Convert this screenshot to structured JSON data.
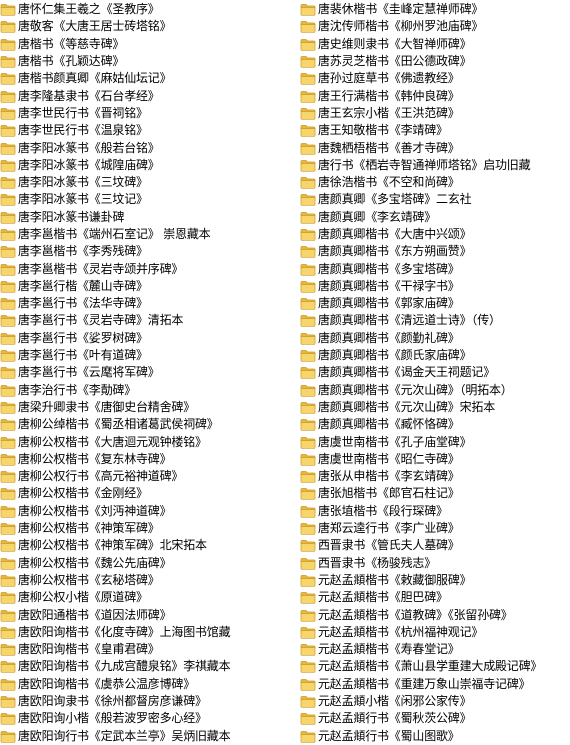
{
  "icon": {
    "name": "folder-icon",
    "body": "#f6d66a",
    "tab": "#e9b936",
    "edge": "#c9982a"
  },
  "left": [
    "唐怀仁集王羲之《圣教序》",
    "唐敬客《大唐王居士砖塔铭》",
    "唐楷书《等慈寺碑》",
    "唐楷书《孔颖达碑》",
    "唐楷书颜真卿《麻姑仙坛记》",
    "唐李隆基隶书《石台孝经》",
    "唐李世民行书《晋祠铭》",
    "唐李世民行书《温泉铭》",
    "唐李阳冰篆书《般若台铭》",
    "唐李阳冰篆书《城隍庙碑》",
    "唐李阳冰篆书《三坟碑》",
    "唐李阳冰篆书《三坟记》",
    "唐李阳冰篆书谦卦碑",
    "唐李邕楷书《端州石室记》 崇恩藏本",
    "唐李邕楷书《李秀残碑》",
    "唐李邕楷书《灵岩寺颂并序碑》",
    "唐李邕行楷《麓山寺碑》",
    "唐李邕行书《法华寺碑》",
    "唐李邕行书《灵岩寺碑》清拓本",
    "唐李邕行书《娑罗树碑》",
    "唐李邕行书《叶有道碑》",
    "唐李邕行书《云麾将军碑》",
    "唐李治行书《李勣碑》",
    "唐梁升卿隶书《唐御史台精舍碑》",
    "唐柳公绰楷书《蜀丞相诸葛武侯祠碑》",
    "唐柳公权楷书《大唐迴元观钟楼铭》",
    "唐柳公权楷书《复东林寺碑》",
    "唐柳公权行书《高元裕神道碑》",
    "唐柳公权楷书《金刚经》",
    "唐柳公权楷书《刘沔神道碑》",
    "唐柳公权楷书《神策军碑》",
    "唐柳公权楷书《神策军碑》北宋拓本",
    "唐柳公权楷书《魏公先庙碑》",
    "唐柳公权楷书《玄秘塔碑》",
    "唐柳公权小楷《原道碑》",
    "唐欧阳通楷书《道因法师碑》",
    "唐欧阳询楷书《化度寺碑》上海图书馆藏",
    "唐欧阳询楷书《皇甫君碑》",
    "唐欧阳询楷书《九成宫醴泉铭》李祺藏本",
    "唐欧阳询楷书《虞恭公温彦博碑》",
    "唐欧阳询隶书《徐州都督房彦谦碑》",
    "唐欧阳询小楷《般若波罗密多心经》",
    "唐欧阳询行书《定武本兰亭》吴炳旧藏本"
  ],
  "right": [
    "唐裴休楷书《圭峰定慧禅师碑》",
    "唐沈传师楷书《柳州罗池庙碑》",
    "唐史维则隶书《大智禅师碑》",
    "唐苏灵芝楷书《田公德政碑》",
    "唐孙过庭草书《佛遗教经》",
    "唐王行满楷书《韩仲良碑》",
    "唐王玄宗小楷《王洪范碑》",
    "唐王知敬楷书《李靖碑》",
    "唐魏栖梧楷书《善才寺碑》",
    "唐行书《栖岩寺智通禅师塔铭》启功旧藏",
    "唐徐浩楷书《不空和尚碑》",
    "唐颜真卿《多宝塔碑》二玄社",
    "唐颜真卿《李玄靖碑》",
    "唐颜真卿楷书《大唐中兴颂》",
    "唐颜真卿楷书《东方朔画赞》",
    "唐颜真卿楷书《多宝塔碑》",
    "唐颜真卿楷书《干禄字书》",
    "唐颜真卿楷书《郭家庙碑》",
    "唐颜真卿楷书《清远道士诗》（传）",
    "唐颜真卿楷书《颜勤礼碑》",
    "唐颜真卿楷书《颜氏家庙碑》",
    "唐颜真卿楷书《谒金天王祠题记》",
    "唐颜真卿楷书《元次山碑》（明拓本）",
    "唐颜真卿楷书《元次山碑》宋拓本",
    "唐颜真卿楷书《臧怀恪碑》",
    "唐虞世南楷书《孔子庙堂碑》",
    "唐虞世南楷书《昭仁寺碑》",
    "唐张从申楷书《李玄靖碑》",
    "唐张旭楷书《郎官石柱记》",
    "唐张埴楷书《段行琛碑》",
    "唐郑云逵行书《李广业碑》",
    "西晋隶书《管氏夫人墓碑》",
    "西晋隶书《杨骏残志》",
    "元赵孟頫楷书《敕藏御服碑》",
    "元赵孟頫楷书《胆巴碑》",
    "元赵孟頫楷书《道教碑》《张留孙碑》",
    "元赵孟頫楷书《杭州福神观记》",
    "元赵孟頫楷书《寿春堂记》",
    "元赵孟頫楷书《萧山县学重建大成殿记碑》",
    "元赵孟頫楷书《重建万象山崇福寺记碑》",
    "元赵孟頫小楷《闲邪公家传》",
    "元赵孟頫行书《蜀秋茨公碑》",
    "元赵孟頫行书《蜀山图歌》"
  ]
}
